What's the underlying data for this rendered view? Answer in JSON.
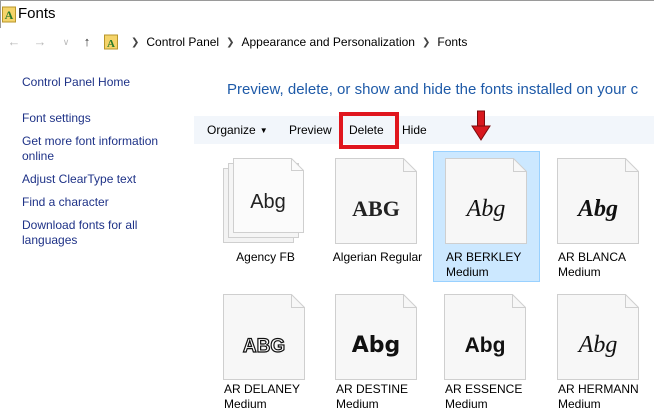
{
  "window": {
    "title": "Fonts",
    "app_icon": "fonts-folder-icon"
  },
  "address": {
    "back_icon": "arrow-left-icon",
    "forward_icon": "arrow-right-icon",
    "recent_icon": "chevron-down-icon",
    "up_icon": "arrow-up-icon",
    "crumbs": [
      "Control Panel",
      "Appearance and Personalization",
      "Fonts"
    ]
  },
  "sidebar": {
    "items": [
      {
        "label": "Control Panel Home"
      },
      {
        "label": "Font settings"
      },
      {
        "label": "Get more font information online"
      },
      {
        "label": "Adjust ClearType text"
      },
      {
        "label": "Find a character"
      },
      {
        "label": "Download fonts for all languages"
      }
    ]
  },
  "main": {
    "headline": "Preview, delete, or show and hide the fonts installed on your c"
  },
  "toolbar": {
    "organize": "Organize",
    "preview": "Preview",
    "delete": "Delete",
    "hide": "Hide",
    "highlight_color": "#e0161e",
    "arrow_color": "#d8181e"
  },
  "fonts": [
    {
      "name": "Agency FB",
      "sample": "Abg",
      "stacked": true,
      "selected": false
    },
    {
      "name": "Algerian Regular",
      "sample": "ABG",
      "stacked": false,
      "selected": false
    },
    {
      "name": "AR BERKLEY Medium",
      "sample": "Abg",
      "stacked": false,
      "selected": true
    },
    {
      "name": "AR BLANCA Medium",
      "sample": "Abg",
      "stacked": false,
      "selected": false
    },
    {
      "name": "AR DELANEY Medium",
      "sample": "ABG",
      "stacked": false,
      "selected": false
    },
    {
      "name": "AR DESTINE Medium",
      "sample": "Abg",
      "stacked": false,
      "selected": false
    },
    {
      "name": "AR ESSENCE Medium",
      "sample": "Abg",
      "stacked": false,
      "selected": false
    },
    {
      "name": "AR HERMANN Medium",
      "sample": "Abg",
      "stacked": false,
      "selected": false
    }
  ]
}
